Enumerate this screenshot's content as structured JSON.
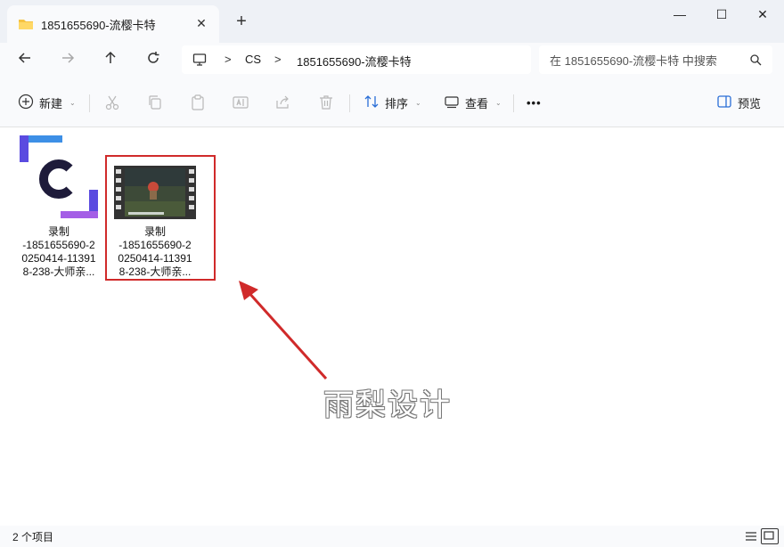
{
  "window": {
    "tab_title": "1851655690-流樱卡特",
    "new_tab_symbol": "+",
    "minimize_symbol": "—",
    "maximize_symbol": "☐",
    "close_symbol": "✕"
  },
  "address": {
    "segments": [
      "CS",
      "1851655690-流樱卡特"
    ],
    "separator": ">",
    "search_placeholder": "在 1851655690-流樱卡特 中搜索"
  },
  "toolbar": {
    "new_label": "新建",
    "sort_label": "排序",
    "view_label": "查看",
    "more_label": "•••",
    "preview_label": "预览",
    "icons": [
      "plus-circle-icon",
      "cut-icon",
      "copy-icon",
      "paste-icon",
      "rename-icon",
      "share-icon",
      "delete-icon",
      "sort-icon",
      "view-icon",
      "preview-pane-icon"
    ]
  },
  "files": [
    {
      "name_lines": [
        "录制",
        "-1851655690-2",
        "0250414-11391",
        "8-238-大师亲..."
      ],
      "icon": "camtasia-logo-icon"
    },
    {
      "name_lines": [
        "录制",
        "-1851655690-2",
        "0250414-11391",
        "8-238-大师亲..."
      ],
      "icon": "video-thumbnail-icon"
    }
  ],
  "watermark": "雨梨设计",
  "status": {
    "item_count": "2 个项目"
  },
  "colors": {
    "highlight": "#d02a2a",
    "accent": "#2a6ed6",
    "camtasia_blue": "#3d8fe6",
    "camtasia_purple": "#a45ee6"
  }
}
